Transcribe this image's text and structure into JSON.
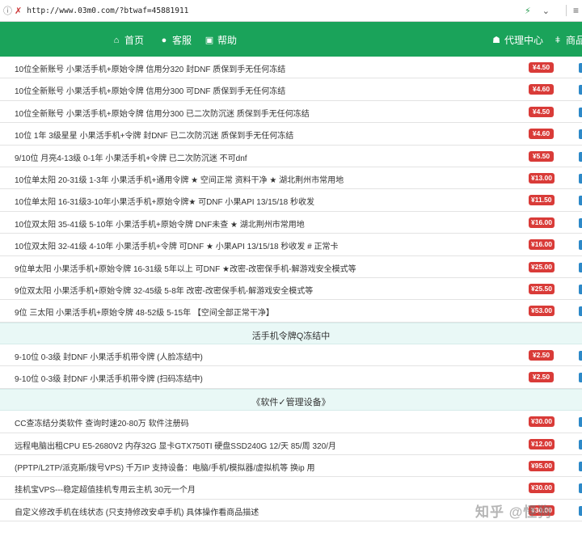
{
  "address_bar": {
    "url": "http://www.03m0.com/?btwaf=45881911"
  },
  "nav": {
    "home": "首页",
    "service": "客服",
    "help": "帮助",
    "agent": "代理中心",
    "goods": "商品"
  },
  "sections": [
    {
      "rows": [
        {
          "text": "10位全新账号 小果活手机+原始令牌 信用分320 封DNF 质保到手无任何冻结",
          "price": "¥4.50"
        },
        {
          "text": "10位全新账号 小果活手机+原始令牌 信用分300 可DNF 质保到手无任何冻结",
          "price": "¥4.60"
        },
        {
          "text": "10位全新账号 小果活手机+原始令牌 信用分300 已二次防沉迷 质保到手无任何冻结",
          "price": "¥4.50"
        },
        {
          "text": "10位 1年 3级星星 小果活手机+令牌 封DNF 已二次防沉迷 质保到手无任何冻结",
          "price": "¥4.60"
        },
        {
          "text": "9/10位 月亮4-13级 0-1年 小果活手机+令牌 已二次防沉迷 不可dnf",
          "price": "¥5.50"
        },
        {
          "text": "10位单太阳 20-31级 1-3年 小果活手机+通用令牌 ★ 空间正常 资料干净 ★ 湖北荆州市常用地",
          "price": "¥13.00"
        },
        {
          "text": "10位单太阳 16-31级3-10年小果活手机+原始令牌★ 可DNF 小果API 13/15/18 秒收发",
          "price": "¥11.50"
        },
        {
          "text": "10位双太阳 35-41级 5-10年 小果活手机+原始令牌 DNF未查 ★ 湖北荆州市常用地",
          "price": "¥16.00"
        },
        {
          "text": "10位双太阳 32-41级 4-10年 小果活手机+令牌 可DNF ★ 小果API 13/15/18 秒收发 # 正常卡",
          "price": "¥16.00"
        },
        {
          "text": "9位单太阳 小果活手机+原始令牌 16-31级 5年以上 可DNF ★改密-改密保手机-解游戏安全模式等",
          "price": "¥25.00"
        },
        {
          "text": "9位双太阳 小果活手机+原始令牌 32-45级 5-8年 改密-改密保手机-解游戏安全模式等",
          "price": "¥25.50"
        },
        {
          "text": "9位 三太阳 小果活手机+原始令牌 48-52级 5-15年 【空间全部正常干净】",
          "price": "¥53.00"
        }
      ]
    },
    {
      "title": "活手机令牌Q冻结中",
      "rows": [
        {
          "text": "9-10位 0-3级 封DNF 小果活手机带令牌 (人脸冻结中)",
          "price": "¥2.50"
        },
        {
          "text": "9-10位 0-3级 封DNF 小果活手机带令牌 (扫码冻结中)",
          "price": "¥2.50"
        }
      ]
    },
    {
      "title": "《软件✓管理设备》",
      "rows": [
        {
          "text": "CC查冻结分类软件 查询时速20-80万 软件注册码",
          "price": "¥30.00"
        },
        {
          "text": "远程电脑出租CPU E5-2680V2 内存32G 显卡GTX750TI 硬盘SSD240G 12/天 85/周 320/月",
          "price": "¥12.00"
        },
        {
          "text": "(PPTP/L2TP/派克斯/拨号VPS) 千万IP 支持设备：电脑/手机/模拟器/虚拟机等 换ip 用",
          "price": "¥95.00"
        },
        {
          "text": "挂机宝VPS---稳定超值挂机专用云主机 30元一个月",
          "price": "¥30.00"
        },
        {
          "text": "自定义修改手机在线状态 (只支持修改安卓手机) 具体操作看商品描述",
          "price": "¥30.00"
        }
      ]
    }
  ],
  "watermark": "知乎 @怪狗"
}
